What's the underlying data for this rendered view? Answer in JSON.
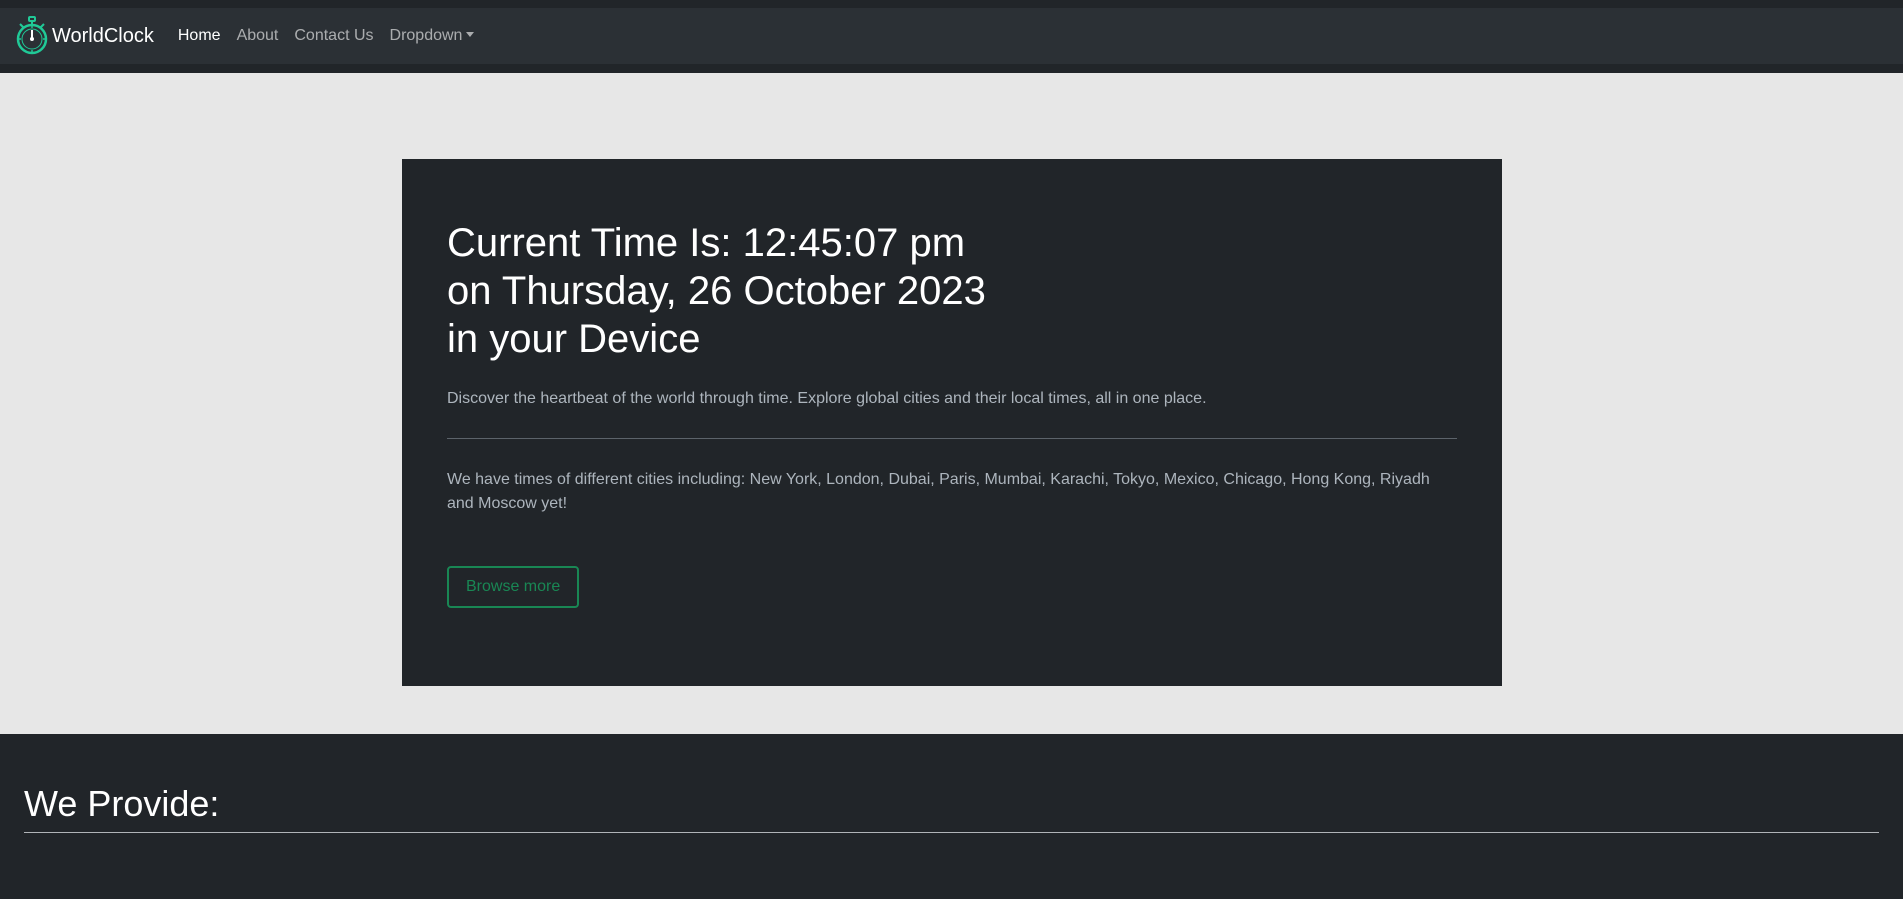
{
  "navbar": {
    "brand": "WorldClock",
    "links": [
      {
        "label": "Home",
        "active": true
      },
      {
        "label": "About",
        "active": false
      },
      {
        "label": "Contact Us",
        "active": false
      },
      {
        "label": "Dropdown",
        "active": false
      }
    ]
  },
  "hero": {
    "title_line1": "Current Time Is: 12:45:07 pm",
    "title_line2": "on Thursday, 26 October 2023",
    "title_line3": "in your Device",
    "lead": "Discover the heartbeat of the world through time. Explore global cities and their local times, all in one place.",
    "description": "We have times of different cities including: New York, London, Dubai, Paris, Mumbai, Karachi, Tokyo, Mexico, Chicago, Hong Kong, Riyadh and Moscow yet!",
    "button_label": "Browse more"
  },
  "provide": {
    "title": "We Provide:"
  },
  "colors": {
    "accent": "#198754",
    "brand_icon": "#20c997",
    "dark": "#212529"
  }
}
